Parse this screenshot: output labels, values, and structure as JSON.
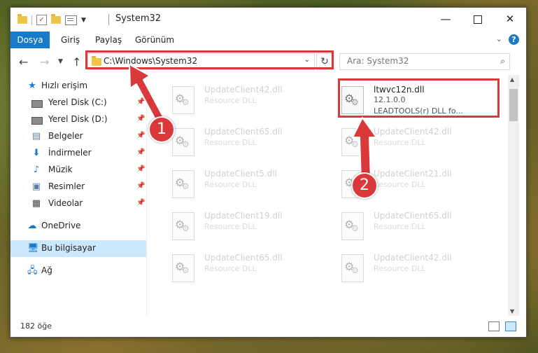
{
  "window": {
    "title": "System32"
  },
  "ribbon": {
    "tabs": [
      "Dosya",
      "Giriş",
      "Paylaş",
      "Görünüm"
    ]
  },
  "address": {
    "path": "C:\\Windows\\System32"
  },
  "search": {
    "placeholder": "Ara: System32"
  },
  "sidebar": {
    "items": [
      {
        "label": "Hızlı erişim",
        "icon": "star-icon",
        "pinned": false
      },
      {
        "label": "Yerel Disk (C:)",
        "icon": "drive-icon",
        "pinned": true
      },
      {
        "label": "Yerel Disk (D:)",
        "icon": "drive-icon",
        "pinned": true
      },
      {
        "label": "Belgeler",
        "icon": "documents-icon",
        "pinned": true
      },
      {
        "label": "İndirmeler",
        "icon": "download-icon",
        "pinned": true
      },
      {
        "label": "Müzik",
        "icon": "music-icon",
        "pinned": true
      },
      {
        "label": "Resimler",
        "icon": "pictures-icon",
        "pinned": true
      },
      {
        "label": "Videolar",
        "icon": "videos-icon",
        "pinned": true
      },
      {
        "label": "OneDrive",
        "icon": "cloud-icon",
        "pinned": false
      },
      {
        "label": "Bu bilgisayar",
        "icon": "computer-icon",
        "pinned": false,
        "selected": true
      },
      {
        "label": "Ağ",
        "icon": "network-icon",
        "pinned": false
      }
    ]
  },
  "files": {
    "left": [
      {
        "name": "UpdateClient42.dll",
        "desc": "Resource DLL"
      },
      {
        "name": "UpdateClient65.dll",
        "desc": "Resource DLL"
      },
      {
        "name": "UpdateClient5.dll",
        "desc": "Resource DLL"
      },
      {
        "name": "UpdateClient19.dll",
        "desc": "Resource DLL"
      },
      {
        "name": "UpdateClient65.dll",
        "desc": "Resource DLL"
      }
    ],
    "right": [
      {
        "name": "UpdateClient42.dll",
        "desc": "Resource DLL"
      },
      {
        "name": "UpdateClient21.dll",
        "desc": "Resource DLL"
      },
      {
        "name": "UpdateClient65.dll",
        "desc": "Resource DLL"
      },
      {
        "name": "UpdateClient42.dll",
        "desc": "Resource DLL"
      }
    ],
    "active": {
      "name": "ltwvc12n.dll",
      "version": "12.1.0.0",
      "desc": "LEADTOOLS(r) DLL fo..."
    }
  },
  "status": {
    "count": "182 öğe"
  },
  "callouts": [
    "1",
    "2"
  ],
  "colors": {
    "accent": "#1979ca",
    "highlight": "#d9393b",
    "selected": "#cce8ff"
  }
}
